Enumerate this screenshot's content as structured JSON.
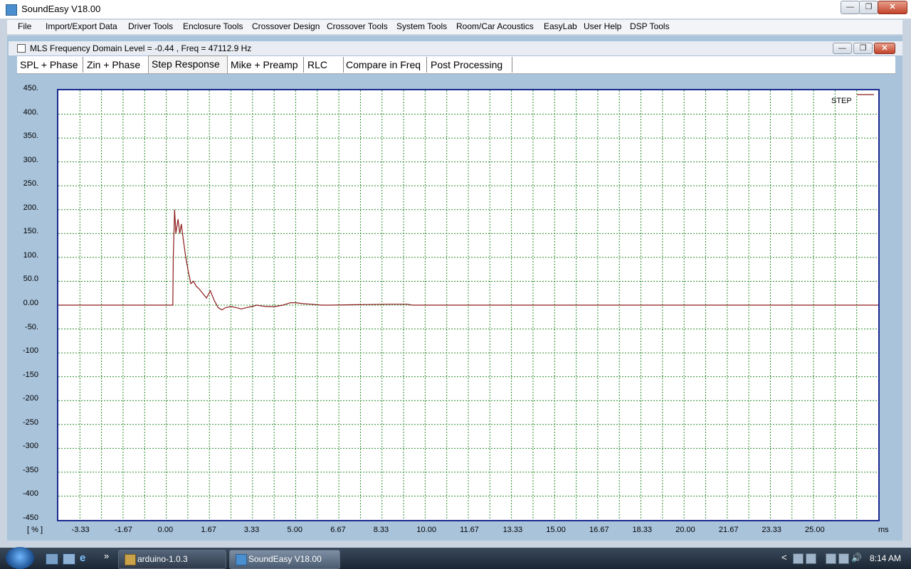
{
  "window": {
    "title": "SoundEasy V18.00",
    "controls": {
      "minimize": "—",
      "restore": "❐",
      "close": "✕"
    }
  },
  "menu": [
    "File",
    "Import/Export Data",
    "Driver Tools",
    "Enclosure Tools",
    "Crossover Design",
    "Crossover Tools",
    "System Tools",
    "Room/Car Acoustics",
    "EasyLab",
    "User Help",
    "DSP Tools"
  ],
  "subwindow": {
    "title": "MLS Frequency Domain  Level = -0.44 , Freq = 47112.9 Hz",
    "controls": {
      "minimize": "—",
      "restore": "❐",
      "close": "✕"
    }
  },
  "tabs": [
    "SPL + Phase",
    "Zin + Phase",
    "Step Response",
    "Mike + Preamp",
    "RLC",
    "Compare in Freq",
    "Post Processing"
  ],
  "active_tab": "Step Response",
  "chart_data": {
    "type": "line",
    "xlabel": "ms",
    "ylabel": "[ % ]",
    "x_ticks": [
      "-3.33",
      "-1.67",
      "0.00",
      "1.67",
      "3.33",
      "5.00",
      "6.67",
      "8.33",
      "10.00",
      "11.67",
      "13.33",
      "15.00",
      "16.67",
      "18.33",
      "20.00",
      "21.67",
      "23.33",
      "25.00"
    ],
    "y_ticks": [
      "450.",
      "400.",
      "350.",
      "300.",
      "250.",
      "200.",
      "150.",
      "100.",
      "50.0",
      "0.00",
      "-50.",
      "-100",
      "-150",
      "-200",
      "-250",
      "-300",
      "-350",
      "-400",
      "-450"
    ],
    "xlim": [
      -4.17,
      27.5
    ],
    "ylim": [
      -450,
      450
    ],
    "grid": true,
    "grid_color": "#2e8b2e",
    "plot_border_color": "#1a2a8f",
    "legend": {
      "position": "top-right"
    },
    "series": [
      {
        "name": "STEP",
        "color": "#8b1a1a",
        "x": [
          -4.17,
          0.25,
          0.27,
          0.32,
          0.37,
          0.45,
          0.52,
          0.58,
          0.65,
          0.75,
          0.85,
          0.95,
          1.05,
          1.15,
          1.25,
          1.4,
          1.55,
          1.7,
          1.85,
          2.0,
          2.15,
          2.3,
          2.5,
          2.7,
          2.9,
          3.1,
          3.3,
          3.5,
          3.7,
          3.9,
          4.2,
          4.5,
          4.8,
          5.0,
          5.3,
          5.6,
          6.0,
          6.3,
          8.6,
          9.3,
          9.5,
          27.5
        ],
        "y": [
          0,
          0,
          100,
          200,
          150,
          180,
          150,
          170,
          140,
          100,
          70,
          45,
          50,
          40,
          35,
          25,
          15,
          30,
          10,
          -5,
          -10,
          -5,
          -3,
          -5,
          -8,
          -5,
          -3,
          0,
          -2,
          -3,
          -3,
          0,
          5,
          5,
          3,
          2,
          0,
          0,
          2,
          2,
          0,
          0
        ]
      }
    ]
  },
  "taskbar": {
    "apps": [
      "arduino-1.0.3",
      "SoundEasy V18.00"
    ],
    "active_app": "SoundEasy V18.00",
    "quick_launch_more": "»",
    "tray_arrow": "<",
    "clock": "8:14 AM"
  }
}
